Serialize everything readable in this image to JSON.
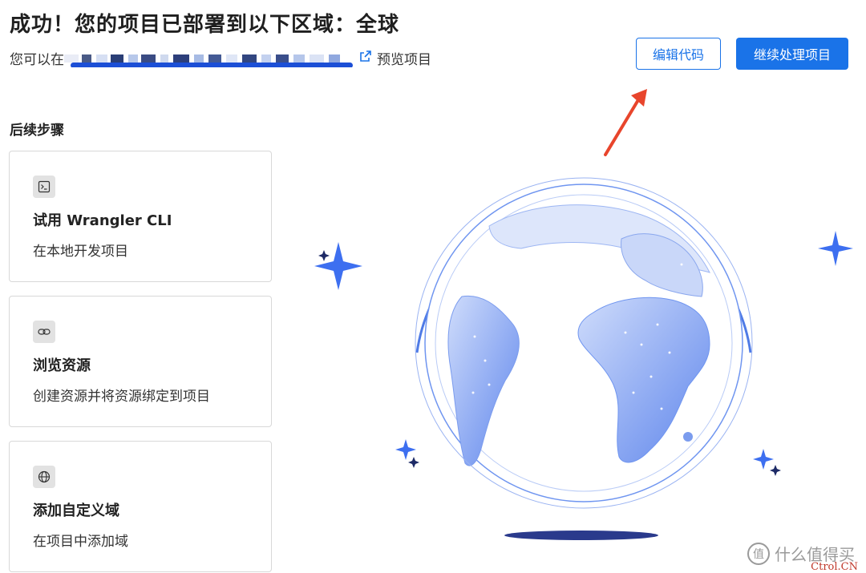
{
  "header": {
    "title": "成功！您的项目已部署到以下区域：全球",
    "sub_prefix": "您可以在",
    "preview_label": "预览项目"
  },
  "actions": {
    "edit_code": "编辑代码",
    "continue": "继续处理项目"
  },
  "next_steps": {
    "title": "后续步骤",
    "cards": [
      {
        "icon": "terminal-icon",
        "title": "试用 Wrangler CLI",
        "desc": "在本地开发项目"
      },
      {
        "icon": "link-icon",
        "title": "浏览资源",
        "desc": "创建资源并将资源绑定到项目"
      },
      {
        "icon": "globe-icon",
        "title": "添加自定义域",
        "desc": "在项目中添加域"
      }
    ]
  },
  "watermark": {
    "text": "什么值得买",
    "glyph": "值",
    "site": "Ctrol.CN"
  },
  "colors": {
    "primary": "#1a73e8",
    "arrow": "#e8452c",
    "globe": "#6f95f0"
  }
}
